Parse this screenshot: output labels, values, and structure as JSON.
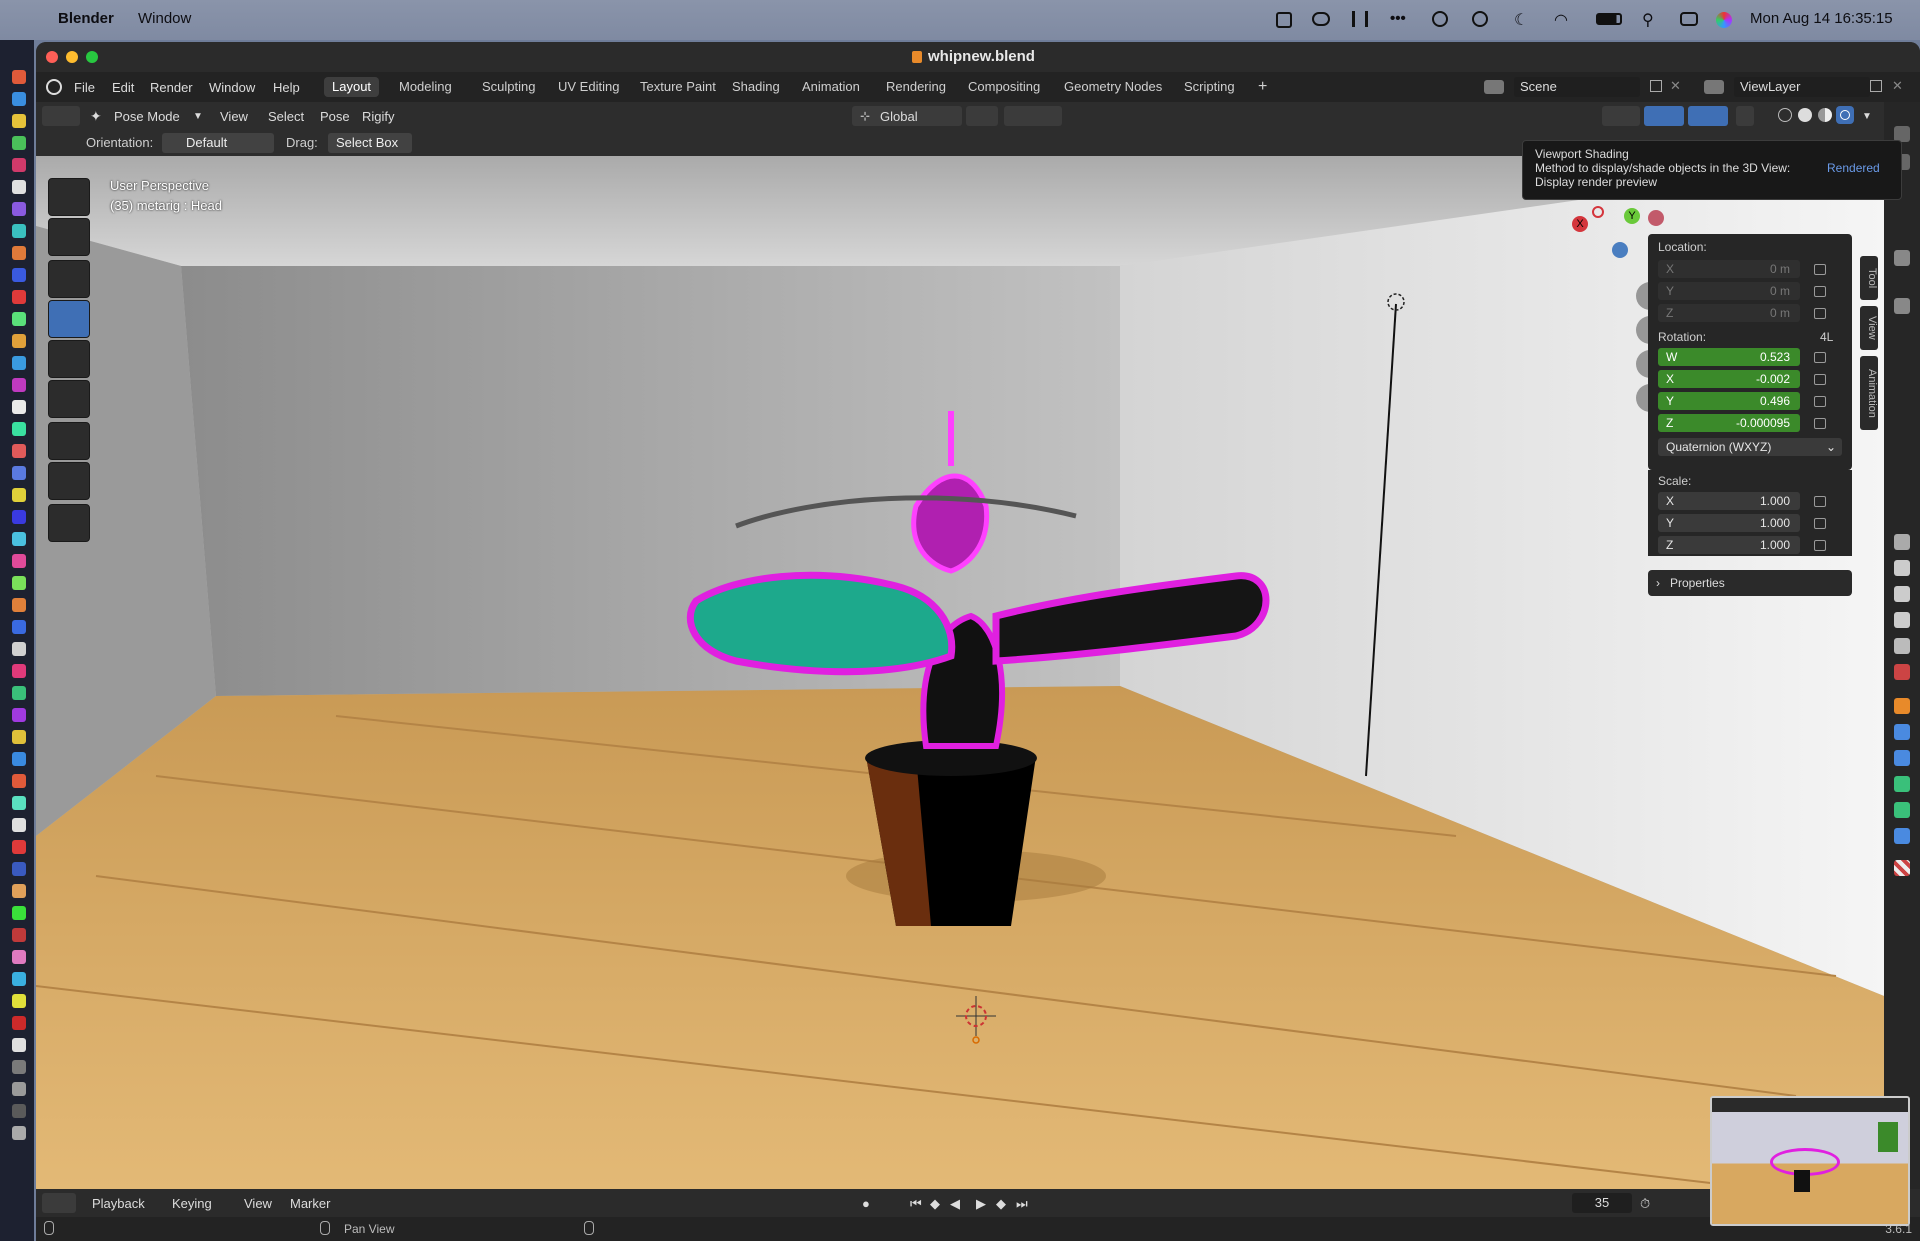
{
  "menubar": {
    "app_name": "Blender",
    "window_menu": "Window",
    "clock": "Mon Aug 14  16:35:15"
  },
  "title": {
    "filename": "whipnew.blend"
  },
  "topbar": {
    "menus": [
      "File",
      "Edit",
      "Render",
      "Window",
      "Help"
    ],
    "workspaces": [
      "Layout",
      "Modeling",
      "Sculpting",
      "UV Editing",
      "Texture Paint",
      "Shading",
      "Animation",
      "Rendering",
      "Compositing",
      "Geometry Nodes",
      "Scripting"
    ],
    "add_workspace": "+",
    "scene": "Scene",
    "view_layer": "ViewLayer"
  },
  "header": {
    "mode": "Pose Mode",
    "menus": [
      "View",
      "Select",
      "Pose",
      "Rigify"
    ],
    "transform_orientation": "Global"
  },
  "header2": {
    "orientation_label": "Orientation:",
    "orientation_value": "Default",
    "drag_label": "Drag:",
    "drag_value": "Select Box"
  },
  "viewport": {
    "perspective": "User Perspective",
    "context": "(35) metarig : Head"
  },
  "gizmo": {
    "x": "X",
    "y": "Y",
    "z": "Z"
  },
  "tooltip": {
    "title": "Viewport Shading",
    "description": "Method to display/shade objects in the 3D View:",
    "value": "Rendered",
    "detail": "Display render preview"
  },
  "npanel": {
    "location_label": "Location:",
    "location": [
      {
        "axis": "X",
        "value": "0 m"
      },
      {
        "axis": "Y",
        "value": "0 m"
      },
      {
        "axis": "Z",
        "value": "0 m"
      }
    ],
    "rotation_label": "Rotation:",
    "rotation_mode_short": "4L",
    "rotation": [
      {
        "axis": "W",
        "value": "0.523"
      },
      {
        "axis": "X",
        "value": "-0.002"
      },
      {
        "axis": "Y",
        "value": "0.496"
      },
      {
        "axis": "Z",
        "value": "-0.000095"
      }
    ],
    "rotation_mode": "Quaternion (WXYZ)",
    "scale_label": "Scale:",
    "scale": [
      {
        "axis": "X",
        "value": "1.000"
      },
      {
        "axis": "Y",
        "value": "1.000"
      },
      {
        "axis": "Z",
        "value": "1.000"
      }
    ],
    "properties_label": "Properties",
    "tabs": [
      "Tool",
      "View",
      "Animation"
    ]
  },
  "timeline": {
    "menus": [
      "Playback",
      "Keying",
      "View",
      "Marker"
    ],
    "current_frame": "35"
  },
  "statusbar": {
    "hint": "Pan View",
    "version": "3.6.1"
  },
  "colors": {
    "accent_blue": "#4772b3",
    "green_field": "#3b8a2a",
    "magenta": "#e020e0",
    "teal": "#21a28a"
  }
}
